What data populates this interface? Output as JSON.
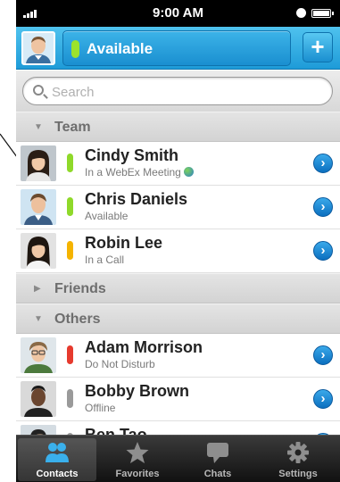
{
  "status_bar": {
    "time": "9:00 AM"
  },
  "header": {
    "presence_label": "Available",
    "add_label": "+"
  },
  "search": {
    "placeholder": "Search"
  },
  "sections": [
    {
      "name": "Team",
      "arrow": "▼"
    },
    {
      "name": "Friends",
      "arrow": "▶"
    },
    {
      "name": "Others",
      "arrow": "▼"
    }
  ],
  "contacts": [
    {
      "name": "Cindy Smith",
      "status": "In a WebEx Meeting",
      "presence_color": "#8fd92a"
    },
    {
      "name": "Chris Daniels",
      "status": "Available",
      "presence_color": "#8fd92a"
    },
    {
      "name": "Robin Lee",
      "status": "In a Call",
      "presence_color": "#f5b400"
    },
    {
      "name": "Adam Morrison",
      "status": "Do Not Disturb",
      "presence_color": "#e63a2e"
    },
    {
      "name": "Bobby Brown",
      "status": "Offline",
      "presence_color": "#9a9a9a"
    },
    {
      "name": "Ben Tao",
      "status": "",
      "presence_color": "#9a9a9a"
    }
  ],
  "tabs": [
    {
      "label": "Contacts",
      "icon": "people-icon",
      "active": true
    },
    {
      "label": "Favorites",
      "icon": "star-icon",
      "active": false
    },
    {
      "label": "Chats",
      "icon": "speech-bubble-icon",
      "active": false
    },
    {
      "label": "Settings",
      "icon": "gear-icon",
      "active": false
    }
  ]
}
